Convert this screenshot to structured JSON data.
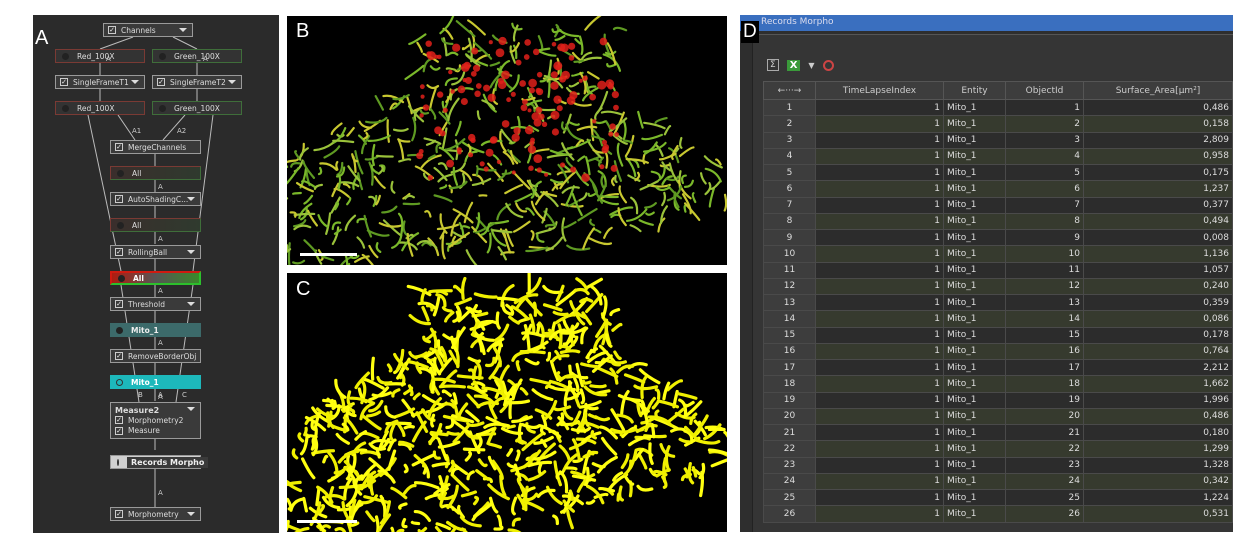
{
  "panel_labels": {
    "a": "A",
    "b": "B",
    "c": "C",
    "d": "D"
  },
  "graph": {
    "nodes": [
      {
        "label": "Channels",
        "kind": "op"
      },
      {
        "label": "Red_100X",
        "kind": "red"
      },
      {
        "label": "Green_100X",
        "kind": "green"
      },
      {
        "label": "SingleFrameT1",
        "kind": "op"
      },
      {
        "label": "SingleFrameT2",
        "kind": "op"
      },
      {
        "label": "Red_100X",
        "kind": "red"
      },
      {
        "label": "Green_100X",
        "kind": "green"
      },
      {
        "label": "MergeChannels",
        "kind": "op-nodd"
      },
      {
        "label": "All",
        "kind": "merged"
      },
      {
        "label": "AutoShadingC...",
        "kind": "op"
      },
      {
        "label": "All",
        "kind": "merged"
      },
      {
        "label": "RollingBall",
        "kind": "op"
      },
      {
        "label": "All",
        "kind": "bright"
      },
      {
        "label": "Threshold",
        "kind": "op"
      },
      {
        "label": "Mito_1",
        "kind": "teal"
      },
      {
        "label": "RemoveBorderObj",
        "kind": "op-nodd"
      },
      {
        "label": "Mito_1",
        "kind": "cyan"
      },
      {
        "label": "Measure2",
        "kind": "measure",
        "items": [
          "Morphometry2",
          "Measure"
        ]
      },
      {
        "label": "Records Morpho",
        "kind": "records"
      },
      {
        "label": "Morphometry",
        "kind": "op"
      }
    ],
    "edge_labels": [
      "A",
      "A",
      "A1",
      "A2",
      "A",
      "A",
      "A",
      "A",
      "A",
      "B",
      "A",
      "C",
      "A"
    ]
  },
  "records": {
    "title": "Records Morpho",
    "toolbar": {
      "sum_icon": "sum-icon",
      "excel_icon": "X",
      "record_icon": "record-icon"
    },
    "columns": [
      "←···→",
      "TimeLapseIndex",
      "Entity",
      "ObjectId",
      "Surface_Area[µm²]"
    ],
    "rows": [
      [
        1,
        1,
        "Mito_1",
        1,
        "0,486"
      ],
      [
        2,
        1,
        "Mito_1",
        2,
        "0,158"
      ],
      [
        3,
        1,
        "Mito_1",
        3,
        "2,809"
      ],
      [
        4,
        1,
        "Mito_1",
        4,
        "0,958"
      ],
      [
        5,
        1,
        "Mito_1",
        5,
        "0,175"
      ],
      [
        6,
        1,
        "Mito_1",
        6,
        "1,237"
      ],
      [
        7,
        1,
        "Mito_1",
        7,
        "0,377"
      ],
      [
        8,
        1,
        "Mito_1",
        8,
        "0,494"
      ],
      [
        9,
        1,
        "Mito_1",
        9,
        "0,008"
      ],
      [
        10,
        1,
        "Mito_1",
        10,
        "1,136"
      ],
      [
        11,
        1,
        "Mito_1",
        11,
        "1,057"
      ],
      [
        12,
        1,
        "Mito_1",
        12,
        "0,240"
      ],
      [
        13,
        1,
        "Mito_1",
        13,
        "0,359"
      ],
      [
        14,
        1,
        "Mito_1",
        14,
        "0,086"
      ],
      [
        15,
        1,
        "Mito_1",
        15,
        "0,178"
      ],
      [
        16,
        1,
        "Mito_1",
        16,
        "0,764"
      ],
      [
        17,
        1,
        "Mito_1",
        17,
        "2,212"
      ],
      [
        18,
        1,
        "Mito_1",
        18,
        "1,662"
      ],
      [
        19,
        1,
        "Mito_1",
        19,
        "1,996"
      ],
      [
        20,
        1,
        "Mito_1",
        20,
        "0,486"
      ],
      [
        21,
        1,
        "Mito_1",
        21,
        "0,180"
      ],
      [
        22,
        1,
        "Mito_1",
        22,
        "1,299"
      ],
      [
        23,
        1,
        "Mito_1",
        23,
        "1,328"
      ],
      [
        24,
        1,
        "Mito_1",
        24,
        "0,342"
      ],
      [
        25,
        1,
        "Mito_1",
        25,
        "1,224"
      ],
      [
        26,
        1,
        "Mito_1",
        26,
        "0,531"
      ]
    ]
  }
}
